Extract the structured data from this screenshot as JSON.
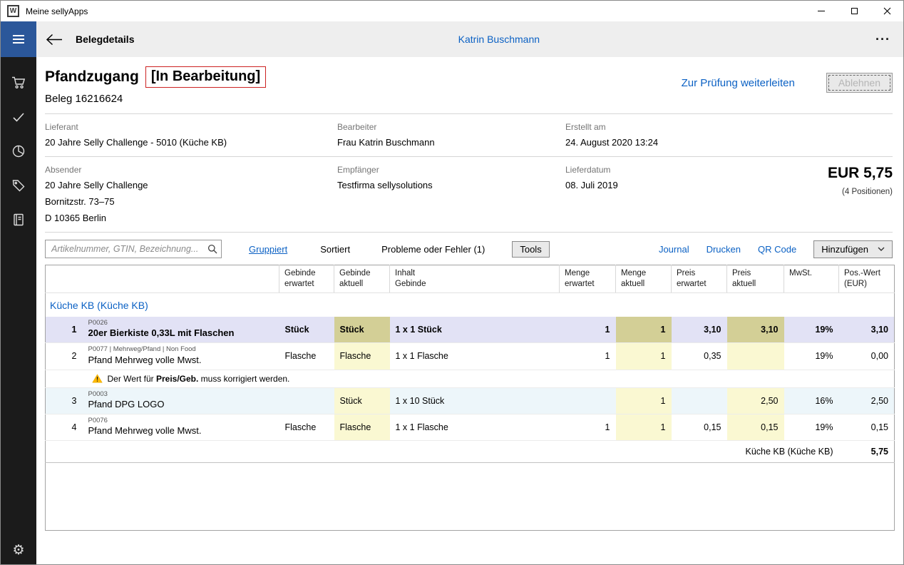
{
  "window": {
    "title": "Meine sellyApps",
    "logo_glyph": "W"
  },
  "header": {
    "title": "Belegdetails",
    "user_name": "Katrin Buschmann",
    "more_label": "···"
  },
  "sidebar": {
    "icon_names": [
      "menu-icon",
      "cart-icon",
      "check-icon",
      "pie-chart-icon",
      "tag-icon",
      "journal-book-icon",
      "settings-gear-icon"
    ],
    "gear_glyph": "⚙"
  },
  "doc": {
    "title": "Pfandzugang",
    "status": "[In Bearbeitung]",
    "number": "Beleg 16216624",
    "forward_action": "Zur Prüfung weiterleiten",
    "reject_action": "Ablehnen",
    "total": "EUR 5,75",
    "positions_count": "(4 Positionen)",
    "info": {
      "lieferant_label": "Lieferant",
      "lieferant": "20 Jahre Selly Challenge - 5010 (Küche KB)",
      "bearbeiter_label": "Bearbeiter",
      "bearbeiter": "Frau Katrin Buschmann",
      "erstellt_label": "Erstellt am",
      "erstellt": "24. August 2020 13:24",
      "absender_label": "Absender",
      "absender_line1": "20 Jahre Selly Challenge",
      "absender_line2": "Bornitzstr. 73–75",
      "absender_line3": "D 10365 Berlin",
      "empfaenger_label": "Empfänger",
      "empfaenger": "Testfirma sellysolutions",
      "lieferdatum_label": "Lieferdatum",
      "lieferdatum": "08. Juli 2019"
    }
  },
  "toolbar": {
    "search_placeholder": "Artikelnummer, GTIN, Bezeichnung...",
    "gruppiert": "Gruppiert",
    "sortiert": "Sortiert",
    "probleme": "Probleme oder Fehler (1)",
    "tools": "Tools",
    "journal": "Journal",
    "drucken": "Drucken",
    "qr_code": "QR Code",
    "hinzufuegen": "Hinzufügen"
  },
  "table": {
    "columns": {
      "gebinde_erwartet": [
        "Gebinde",
        "erwartet"
      ],
      "gebinde_aktuell": [
        "Gebinde",
        "aktuell"
      ],
      "inhalt_gebinde": [
        "Inhalt",
        "Gebinde"
      ],
      "menge_erwartet": [
        "Menge",
        "erwartet"
      ],
      "menge_aktuell": [
        "Menge",
        "aktuell"
      ],
      "preis_erwartet": [
        "Preis",
        "erwartet"
      ],
      "preis_aktuell": [
        "Preis",
        "aktuell"
      ],
      "mwst": [
        "MwSt.",
        ""
      ],
      "pos_wert": [
        "Pos.-Wert",
        "(EUR)"
      ]
    },
    "group_title": "Küche KB (Küche KB)",
    "rows": [
      {
        "num": "1",
        "code": "P0026",
        "name": "20er Bierkiste 0,33L mit Flaschen",
        "gebinde_erwartet": "Stück",
        "gebinde_aktuell": "Stück",
        "inhalt": "1 x 1 Stück",
        "menge_erwartet": "1",
        "menge_aktuell": "1",
        "preis_erwartet": "3,10",
        "preis_aktuell": "3,10",
        "mwst": "19%",
        "pos_wert": "3,10"
      },
      {
        "num": "2",
        "code": "P0077 | Mehrweg/Pfand | Non Food",
        "name": "Pfand Mehrweg volle Mwst.",
        "gebinde_erwartet": "Flasche",
        "gebinde_aktuell": "Flasche",
        "inhalt": "1 x 1 Flasche",
        "menge_erwartet": "1",
        "menge_aktuell": "1",
        "preis_erwartet": "0,35",
        "preis_aktuell": "",
        "mwst": "19%",
        "pos_wert": "0,00"
      },
      {
        "num": "3",
        "code": "P0003",
        "name": "Pfand DPG LOGO",
        "gebinde_erwartet": "",
        "gebinde_aktuell": "Stück",
        "inhalt": "1 x 10 Stück",
        "menge_erwartet": "",
        "menge_aktuell": "1",
        "preis_erwartet": "",
        "preis_aktuell": "2,50",
        "mwst": "16%",
        "pos_wert": "2,50"
      },
      {
        "num": "4",
        "code": "P0076",
        "name": "Pfand Mehrweg volle Mwst.",
        "gebinde_erwartet": "Flasche",
        "gebinde_aktuell": "Flasche",
        "inhalt": "1 x 1 Flasche",
        "menge_erwartet": "1",
        "menge_aktuell": "1",
        "preis_erwartet": "0,15",
        "preis_aktuell": "0,15",
        "mwst": "19%",
        "pos_wert": "0,15"
      }
    ],
    "warning": {
      "prefix": "Der Wert für ",
      "bold": "Preis/Geb.",
      "suffix": " muss korrigiert werden."
    },
    "footer": {
      "label": "Küche KB (Küche KB)",
      "value": "5,75"
    }
  },
  "colors": {
    "accent_blue": "#2b579a",
    "link_blue": "#0b61c4",
    "status_border_red": "#cc2222",
    "edited_cell_yellow": "#faf8d2",
    "edited_cell_selected_khaki": "#d3cf96",
    "selected_row_lavender": "#e2e2f5",
    "alt_row_blue": "#edf6fa",
    "warning_yellow": "#ffb900",
    "sidebar_dark": "#1b1b1b"
  }
}
